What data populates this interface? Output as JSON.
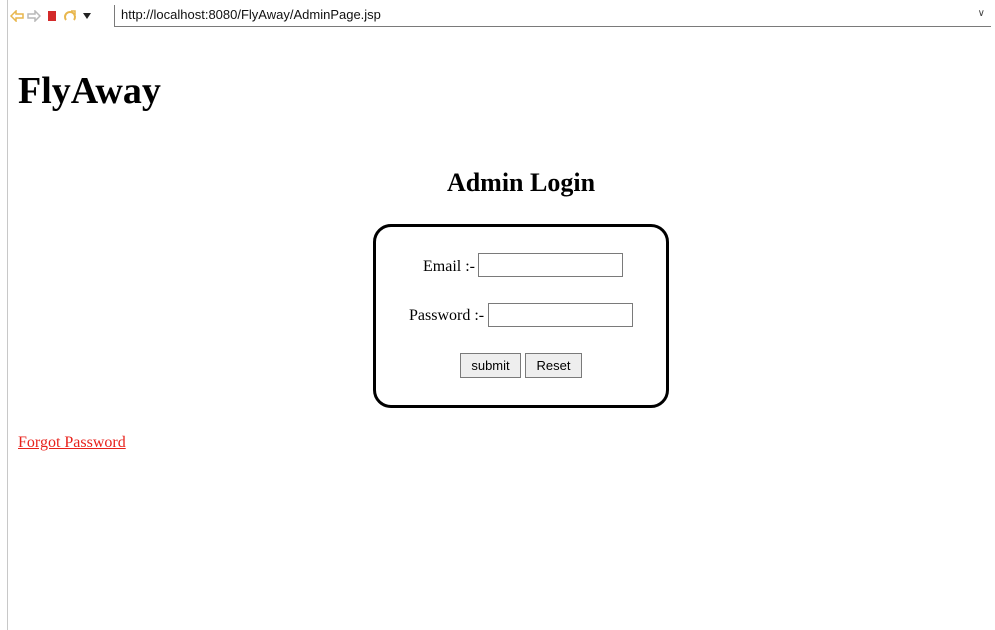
{
  "browser": {
    "url": "http://localhost:8080/FlyAway/AdminPage.jsp",
    "icons": {
      "back": "back-arrow-icon",
      "forward": "forward-arrow-icon",
      "stop": "stop-icon",
      "refresh": "refresh-icon",
      "menu": "dropdown-arrow-icon",
      "url_dropdown": "chevron-down-icon",
      "go": "go-icon"
    },
    "glyphs": {
      "back": "⇦",
      "forward": "⇨",
      "menu": "▾",
      "url_dropdown": "∨"
    },
    "colors": {
      "nav_arrow": "#e8b64c",
      "stop": "#d32a2a"
    }
  },
  "page": {
    "site_title": "FlyAway",
    "login_heading": "Admin Login",
    "form": {
      "email_label": "Email :-",
      "email_value": "",
      "password_label": "Password :-",
      "password_value": "",
      "submit_label": "submit",
      "reset_label": "Reset"
    },
    "forgot_password_link": "Forgot Password",
    "colors": {
      "link": "#e8211b"
    }
  }
}
